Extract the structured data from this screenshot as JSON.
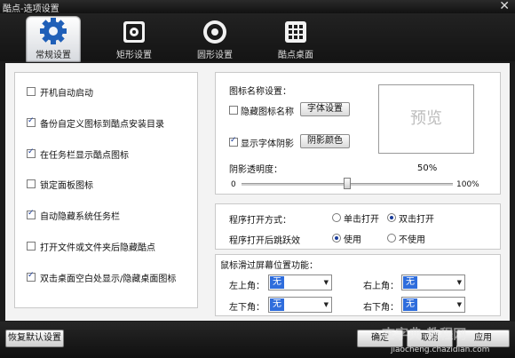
{
  "window": {
    "title": "酷点-选项设置",
    "close": "✕"
  },
  "tabs": [
    {
      "label": "常规设置",
      "icon": "gear-icon"
    },
    {
      "label": "矩形设置",
      "icon": "cog-square-icon"
    },
    {
      "label": "圆形设置",
      "icon": "circle-icon"
    },
    {
      "label": "酷点桌面",
      "icon": "desktop-grid-icon"
    }
  ],
  "left_options": [
    {
      "label": "开机自动启动",
      "checked": false
    },
    {
      "label": "备份自定义图标到酷点安装目录",
      "checked": true
    },
    {
      "label": "在任务栏显示酷点图标",
      "checked": true
    },
    {
      "label": "锁定面板图标",
      "checked": false
    },
    {
      "label": "自动隐藏系统任务栏",
      "checked": true
    },
    {
      "label": "打开文件或文件夹后隐藏酷点",
      "checked": false
    },
    {
      "label": "双击桌面空白处显示/隐藏桌面图标",
      "checked": true
    }
  ],
  "icon_name": {
    "heading": "图标名称设置：",
    "hide_label": "隐藏图标名称",
    "hide_checked": false,
    "font_button": "字体设置",
    "shadow_label": "显示字体阴影",
    "shadow_checked": true,
    "shadow_button": "阴影颜色",
    "preview": "预览",
    "opacity_label": "阴影透明度：",
    "opacity_value": "50%",
    "opacity_fraction": 0.5,
    "min": "0",
    "max": "100%"
  },
  "program": {
    "open_label": "程序打开方式：",
    "single": "单击打开",
    "double": "双击打开",
    "bounce_label": "程序打开后跳跃效",
    "use": "使用",
    "not_use": "不使用"
  },
  "corners": {
    "heading": "鼠标滑过屏幕位置功能：",
    "top_left": "左上角：",
    "top_right": "右上角：",
    "bottom_left": "左下角：",
    "bottom_right": "右下角：",
    "value": "无"
  },
  "footer": {
    "reset": "恢复默认设置",
    "ok": "确定",
    "cancel": "取消",
    "apply": "应用"
  },
  "watermark": {
    "text": "查字典 教程网",
    "url": "jiaocheng.chazidian.com"
  }
}
